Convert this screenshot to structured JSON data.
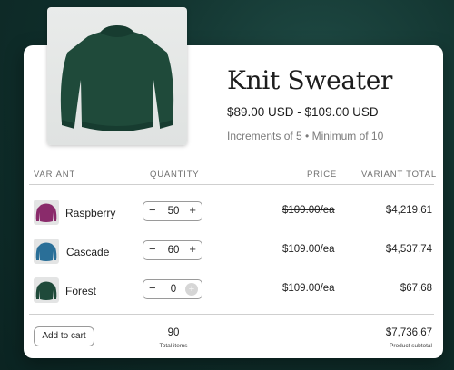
{
  "product": {
    "title": "Knit Sweater",
    "price_range": "$89.00 USD - $109.00 USD",
    "rules": "Increments of 5 • Minimum of 10",
    "image_icon": "sweater-image"
  },
  "table": {
    "headers": {
      "variant": "VARIANT",
      "quantity": "QUANTITY",
      "price": "PRICE",
      "variant_total": "VARIANT TOTAL"
    },
    "rows": [
      {
        "name": "Raspberry",
        "color": "#8a2b6b",
        "minus": "−",
        "quantity": "50",
        "plus": "+",
        "price": "$109.00/ea",
        "price_struck": true,
        "total": "$4,219.61"
      },
      {
        "name": "Cascade",
        "color": "#2a6f98",
        "minus": "−",
        "quantity": "60",
        "plus": "+",
        "price": "$109.00/ea",
        "price_struck": false,
        "total": "$4,537.74"
      },
      {
        "name": "Forest",
        "color": "#1f4a3a",
        "minus": "−",
        "quantity": "0",
        "plus": "+",
        "plus_disabled": true,
        "price": "$109.00/ea",
        "price_struck": false,
        "total": "$67.68"
      }
    ]
  },
  "footer": {
    "add_to_cart": "Add to cart",
    "total_items_value": "90",
    "total_items_label": "Total items",
    "subtotal_value": "$7,736.67",
    "subtotal_label": "Product subtotal"
  },
  "colors": {
    "background": "#10302c",
    "card": "#ffffff",
    "sweater": "#1f4a3a"
  }
}
